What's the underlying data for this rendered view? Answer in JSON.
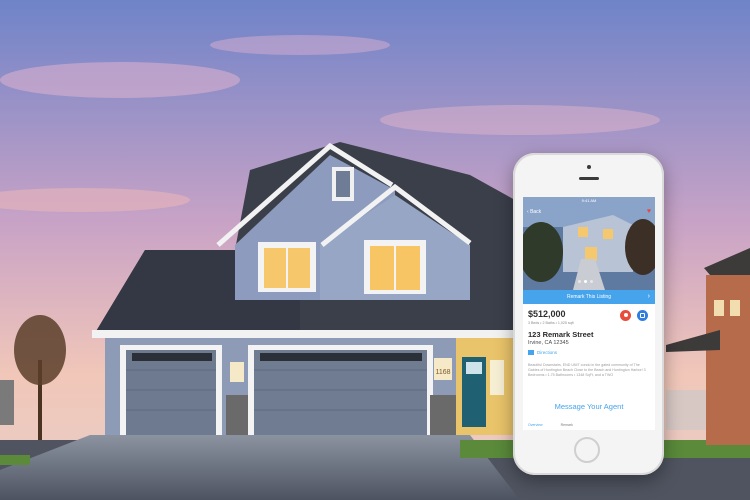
{
  "scene": {
    "sky_top": "#6f83c8",
    "sky_mid": "#c9a3c6",
    "sky_low": "#f1c7b9",
    "house_number": "1168"
  },
  "phone": {
    "status_time": "9:41 AM",
    "back_label": "Back",
    "remark_button_label": "Remark This Listing",
    "price": "$512,000",
    "beds_baths_sqft": "3 Beds • 2 Baths • 1,025 sqft",
    "street": "123 Remark Street",
    "city_state_zip": "Irvine, CA 12345",
    "directions_label": "Directions",
    "description": "Beautiful Downstairs, END UNIT condo in the gated community of The Gables of Huntington Beach Close to the Beach and Huntington Harbor! 3 Bedrooms • 1.75 Bathrooms • 1348 SqFt, and a TWO",
    "message_button_label": "Message Your Agent",
    "footer_tabs": [
      "Overview",
      "Remark"
    ],
    "accent": "#45a4ec",
    "pin_color": "#e74c3c",
    "share_color": "#2f7de1",
    "icons": [
      "heart-icon",
      "map-pin-icon",
      "share-icon",
      "map-icon",
      "chevron-right-icon"
    ]
  }
}
